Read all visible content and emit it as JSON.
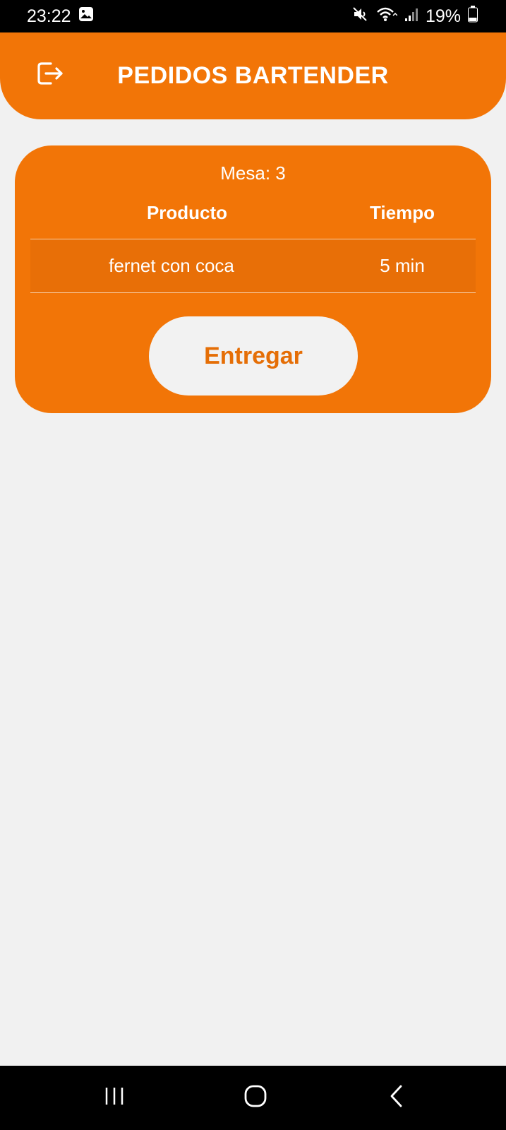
{
  "status_bar": {
    "time": "23:22",
    "battery": "19%",
    "icons": [
      "gallery-icon",
      "mute-icon",
      "wifi-icon",
      "signal-icon",
      "battery-icon"
    ]
  },
  "header": {
    "title": "PEDIDOS BARTENDER",
    "logout_icon": "logout-icon"
  },
  "order": {
    "mesa_label": "Mesa: 3",
    "columns": {
      "product": "Producto",
      "time": "Tiempo"
    },
    "rows": [
      {
        "product": "fernet con coca",
        "time": "5 min"
      }
    ],
    "deliver_label": "Entregar"
  },
  "nav": {
    "icons": [
      "recents-icon",
      "home-icon",
      "back-icon"
    ]
  },
  "colors": {
    "accent": "#f27507",
    "row": "#e86f07",
    "background": "#f1f1f1",
    "button_bg": "#f2f2f2",
    "button_text": "#e56e06"
  }
}
